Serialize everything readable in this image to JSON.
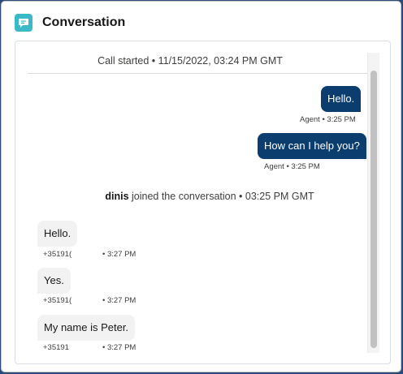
{
  "card": {
    "title": "Conversation",
    "icon": "chat-bubble-icon",
    "icon_color": "#3bb9c6"
  },
  "transcript": {
    "call_started": "Call started • 11/15/2022, 03:24 PM GMT",
    "join_event": {
      "name": "dinis",
      "text": " joined the conversation • 03:25 PM GMT"
    },
    "agent_messages": [
      {
        "text": "Hello.",
        "meta": "Agent • 3:25 PM"
      },
      {
        "text": "How can I help you?",
        "meta": "Agent • 3:25 PM"
      }
    ],
    "customer_messages": [
      {
        "text": "Hello.",
        "sender": "+35191(",
        "time": "• 3:27 PM"
      },
      {
        "text": "Yes.",
        "sender": "+35191(",
        "time": "• 3:27 PM"
      },
      {
        "text": "My name is Peter.",
        "sender": "+35191",
        "time": "• 3:27 PM"
      }
    ]
  },
  "colors": {
    "agent_bubble": "#0b3d6e",
    "customer_bubble": "#f3f2f2"
  }
}
